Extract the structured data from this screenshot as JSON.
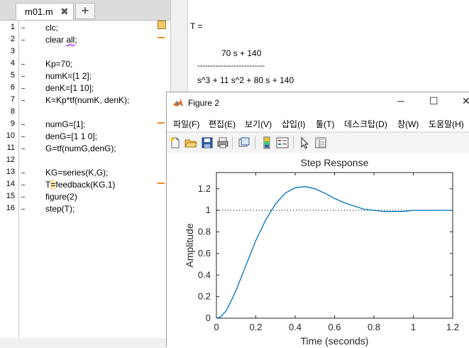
{
  "editor": {
    "tab_label": "m01.m",
    "tab_close": "✖",
    "new_tab": "+",
    "lines": [
      {
        "n": "1",
        "code": "clc;"
      },
      {
        "n": "2",
        "code": "clear all;"
      },
      {
        "n": "3",
        "code": ""
      },
      {
        "n": "4",
        "code": "Kp=70;"
      },
      {
        "n": "5",
        "code": "numK=[1 2];"
      },
      {
        "n": "6",
        "code": "denK=[1 10];"
      },
      {
        "n": "7",
        "code": "K=Kp*tf(numK, denK);"
      },
      {
        "n": "8",
        "code": ""
      },
      {
        "n": "9",
        "code": "numG=[1];"
      },
      {
        "n": "10",
        "code": "denG=[1 1 0];"
      },
      {
        "n": "11",
        "code": "G=tf(numG,denG);"
      },
      {
        "n": "12",
        "code": ""
      },
      {
        "n": "13",
        "code": "KG=series(K,G);"
      },
      {
        "n": "14",
        "code": "T=feedback(KG,1)"
      },
      {
        "n": "15",
        "code": "figure(2)"
      },
      {
        "n": "16",
        "code": "step(T);"
      }
    ]
  },
  "command_window": {
    "var_line": "T =",
    "numerator": "70 s + 140",
    "fraction_bar": "--------------------------",
    "denominator": "s^3 + 11 s^2 + 80 s + 140"
  },
  "figure": {
    "title": "Figure 2",
    "window_buttons": {
      "minimize": "─",
      "maximize": "☐",
      "close": "✕"
    },
    "menus": [
      "파일(F)",
      "편집(E)",
      "보기(V)",
      "삽입(I)",
      "툴(T)",
      "데스크탑(D)",
      "창(W)",
      "도움말(H)"
    ],
    "toolbar_icons": [
      "new-figure-icon",
      "open-file-icon",
      "save-icon",
      "print-icon",
      "link-plot-icon",
      "insert-colorbar-icon",
      "insert-legend-icon",
      "edit-plot-icon",
      "property-inspector-icon"
    ]
  },
  "chart_data": {
    "type": "line",
    "title": "Step Response",
    "xlabel": "Time (seconds)",
    "ylabel": "Amplitude",
    "xlim": [
      0,
      1.2
    ],
    "ylim": [
      0,
      1.35
    ],
    "xticks": [
      "0",
      "0.2",
      "0.4",
      "0.6",
      "0.8",
      "1",
      "1.2"
    ],
    "yticks": [
      "0",
      "0.2",
      "0.4",
      "0.6",
      "0.8",
      "1",
      "1.2"
    ],
    "reference_line": {
      "y": 1,
      "style": "dotted"
    },
    "series": [
      {
        "color": "#0072bd",
        "x": [
          0,
          0.02,
          0.05,
          0.08,
          0.1,
          0.15,
          0.2,
          0.25,
          0.3,
          0.35,
          0.4,
          0.45,
          0.5,
          0.55,
          0.6,
          0.65,
          0.7,
          0.75,
          0.8,
          0.85,
          0.9,
          0.95,
          1.0,
          1.05,
          1.1,
          1.15,
          1.2
        ],
        "y": [
          0,
          0.01,
          0.07,
          0.18,
          0.26,
          0.49,
          0.72,
          0.91,
          1.06,
          1.16,
          1.21,
          1.22,
          1.2,
          1.16,
          1.11,
          1.07,
          1.04,
          1.01,
          1.0,
          0.99,
          0.99,
          0.99,
          1.0,
          1.0,
          1.0,
          1.0,
          1.0
        ]
      }
    ]
  }
}
